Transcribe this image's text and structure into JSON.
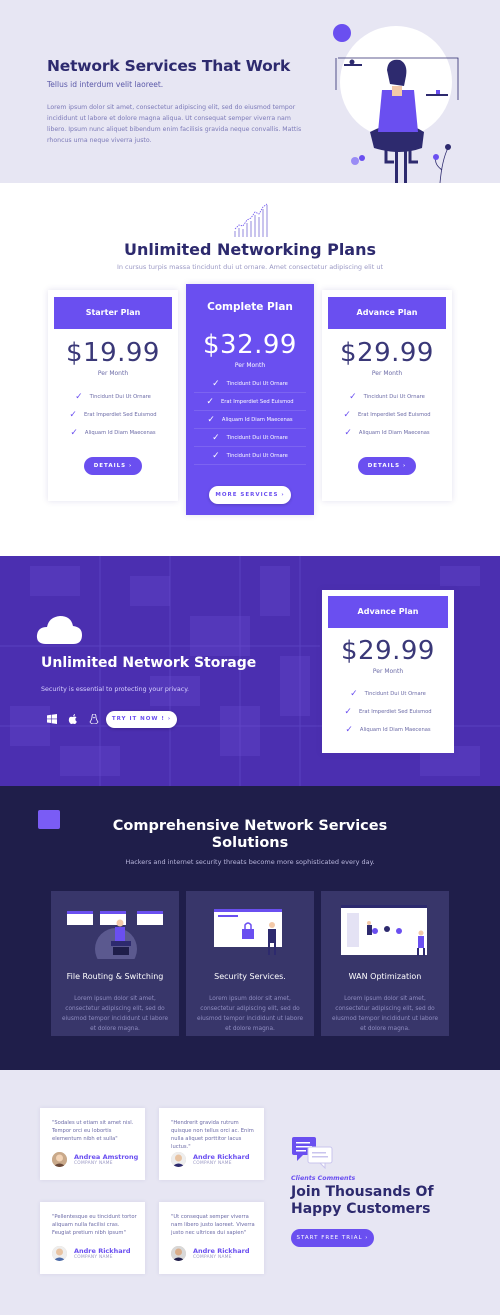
{
  "hero": {
    "title": "Network Services That Work",
    "subtitle": "Tellus id interdum velit laoreet.",
    "body": "Lorem ipsum dolor sit amet, consectetur adipiscing elit, sed do eiusmod tempor incididunt ut labore et dolore magna aliqua. Ut consequat semper viverra nam libero. Ipsum nunc aliquet bibendum enim facilisis gravida neque convallis. Mattis rhoncus urna neque viverra justo."
  },
  "plans": {
    "title": "Unlimited Networking Plans",
    "subtitle": "In cursus turpis massa tincidunt dui ut ornare. Amet consectetur adipiscing elit ut",
    "cards": [
      {
        "name": "Starter Plan",
        "price": "$19.99",
        "period": "Per Month",
        "features": [
          "Tincidunt Dui Ut Ornare",
          "Erat Imperdiet Sed Euismod",
          "Aliquam Id Diam Maecenas"
        ],
        "button": "DETAILS"
      },
      {
        "name": "Complete Plan",
        "price": "$32.99",
        "period": "Per Month",
        "features": [
          "Tincidunt Dui Ut Ornare",
          "Erat Imperdiet Sed Euismod",
          "Aliquam Id Diam Maecenas",
          "Tincidunt Dui Ut Ornare",
          "Tincidunt Dui Ut Ornare"
        ],
        "button": "MORE SERVICES"
      },
      {
        "name": "Advance Plan",
        "price": "$29.99",
        "period": "Per Month",
        "features": [
          "Tincidunt Dui Ut Ornare",
          "Erat Imperdiet Sed Euismod",
          "Aliquam Id Diam Maecenas"
        ],
        "button": "DETAILS"
      }
    ]
  },
  "storage": {
    "title": "Unlimited Network Storage",
    "subtitle": "Security is essential to protecting your privacy.",
    "button": "TRY IT NOW !",
    "os_icons": [
      "windows-icon",
      "apple-icon",
      "linux-icon"
    ],
    "card": {
      "name": "Advance Plan",
      "price": "$29.99",
      "period": "Per Month",
      "features": [
        "Tincidunt Dui Ut Ornare",
        "Erat Imperdiet Sed Euismod",
        "Aliquam Id Diam Maecenas"
      ]
    }
  },
  "services": {
    "title_line1": "Comprehensive Network Services",
    "title_line2": "Solutions",
    "subtitle": "Hackers and internet security threats become more sophisticated every day.",
    "items": [
      {
        "title": "File Routing & Switching",
        "body": "Lorem ipsum dolor sit amet, consectetur adipiscing elit, sed do eiusmod tempor incididunt ut labore et dolore magna."
      },
      {
        "title": "Security Services.",
        "body": "Lorem ipsum dolor sit amet, consectetur adipiscing elit, sed do eiusmod tempor incididunt ut labore et dolore magna."
      },
      {
        "title": "WAN Optimization",
        "body": "Lorem ipsum dolor sit amet, consectetur adipiscing elit, sed do eiusmod tempor incididunt ut labore et dolore magna."
      }
    ]
  },
  "testimonials": {
    "tag": "Clients Comments",
    "title": "Join Thousands Of Happy Customers",
    "button": "START FREE TRIAL",
    "items": [
      {
        "quote": "\"Sodales ut etiam sit amet nisl. Tempor orci eu lobortis elementum nibh et sulla\"",
        "name": "Andrea Amstrong",
        "company": "COMPANY NAME"
      },
      {
        "quote": "\"Hendrerit gravida rutrum quisque non tellus orci ac. Enim nulla aliquet porttitor lacus luctus.\"",
        "name": "Andre Rickhard",
        "company": "COMPANY NAME"
      },
      {
        "quote": "\"Pellentesque eu tincidunt tortor aliquam nulla facilisi cras. Feugiat pretium nibh ipsum\"",
        "name": "Andre Rickhard",
        "company": "COMPANY NAME"
      },
      {
        "quote": "\"Ut consequat semper viverra nam libero justo laoreet. Viverra justo nec ultrices dui sapien\"",
        "name": "Andre Rickhard",
        "company": "COMPANY NAME"
      }
    ]
  },
  "colors": {
    "accent": "#6a4ff0",
    "dark": "#1f1e4a",
    "hero_bg": "#e7e6f3",
    "storage_bg": "#4b2fb0"
  }
}
